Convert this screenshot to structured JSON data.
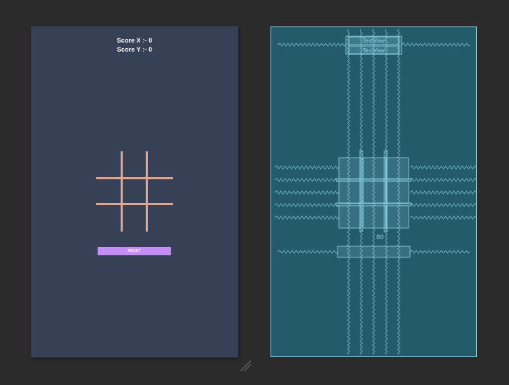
{
  "design_view": {
    "score_x": "Score X :- 0",
    "score_y": "Score Y :- 0",
    "reset_label": "RESET"
  },
  "blueprint_view": {
    "textview_1": "TextView",
    "textview_2": "TextView",
    "margin_label": "80"
  },
  "colors": {
    "canvas_bg": "#2b2b2b",
    "design_bg": "#364057",
    "grid_line": "#f0a382",
    "reset_button": "#c58ef5",
    "blueprint_bg": "#235b6b",
    "blueprint_line": "#8fd4e6"
  },
  "icons": {
    "resize_handle": "resize-handle-icon"
  }
}
